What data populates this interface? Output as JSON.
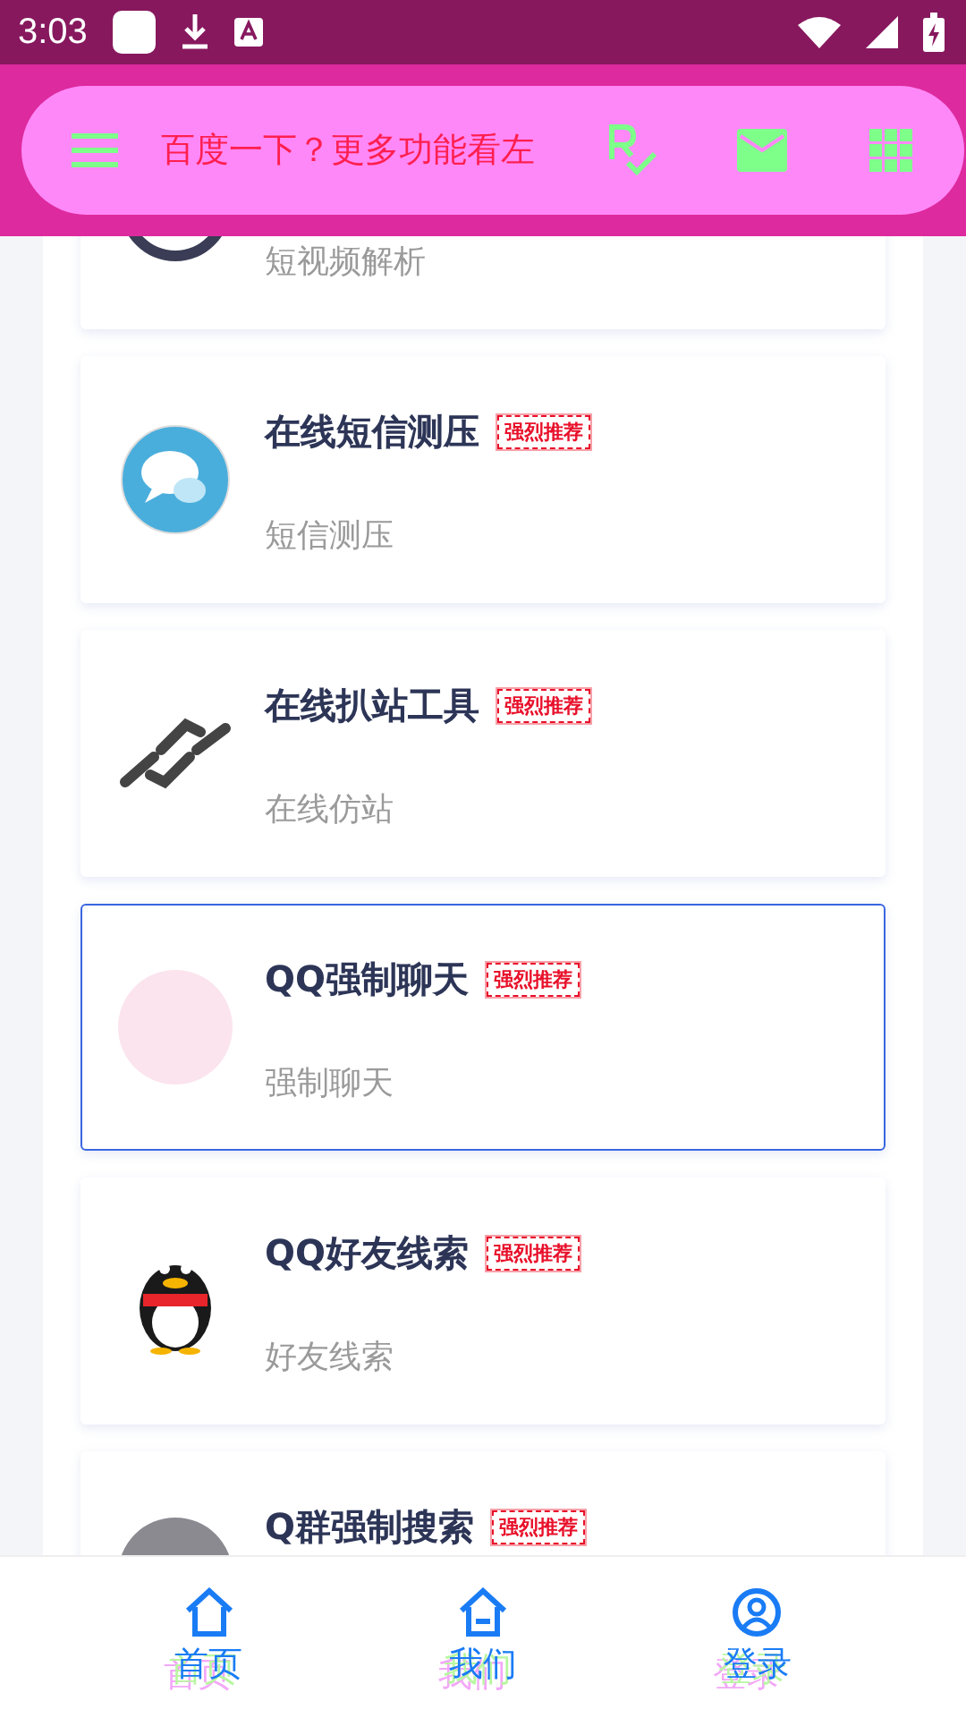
{
  "status_bar": {
    "time": "3:03"
  },
  "header": {
    "search_text": "百度一下？更多功能看左"
  },
  "cards": [
    {
      "kind": "video",
      "subtitle": "短视频解析",
      "selected": false
    },
    {
      "kind": "chat",
      "title": "在线短信测压",
      "subtitle": "短信测压",
      "badge": "强烈推荐",
      "selected": false
    },
    {
      "kind": "link",
      "title": "在线扒站工具",
      "subtitle": "在线仿站",
      "badge": "强烈推荐",
      "selected": false
    },
    {
      "kind": "picture",
      "title": "QQ强制聊天",
      "subtitle": "强制聊天",
      "badge": "强烈推荐",
      "selected": true
    },
    {
      "kind": "penguin",
      "title": "QQ好友线索",
      "subtitle": "好友线索",
      "badge": "强烈推荐",
      "selected": false
    },
    {
      "kind": "photo",
      "title": "Q群强制搜索",
      "badge": "强烈推荐",
      "selected": false
    }
  ],
  "nav": [
    {
      "kind": "home",
      "label": "首页"
    },
    {
      "kind": "house",
      "label": "我们"
    },
    {
      "kind": "user",
      "label": "登录"
    }
  ]
}
